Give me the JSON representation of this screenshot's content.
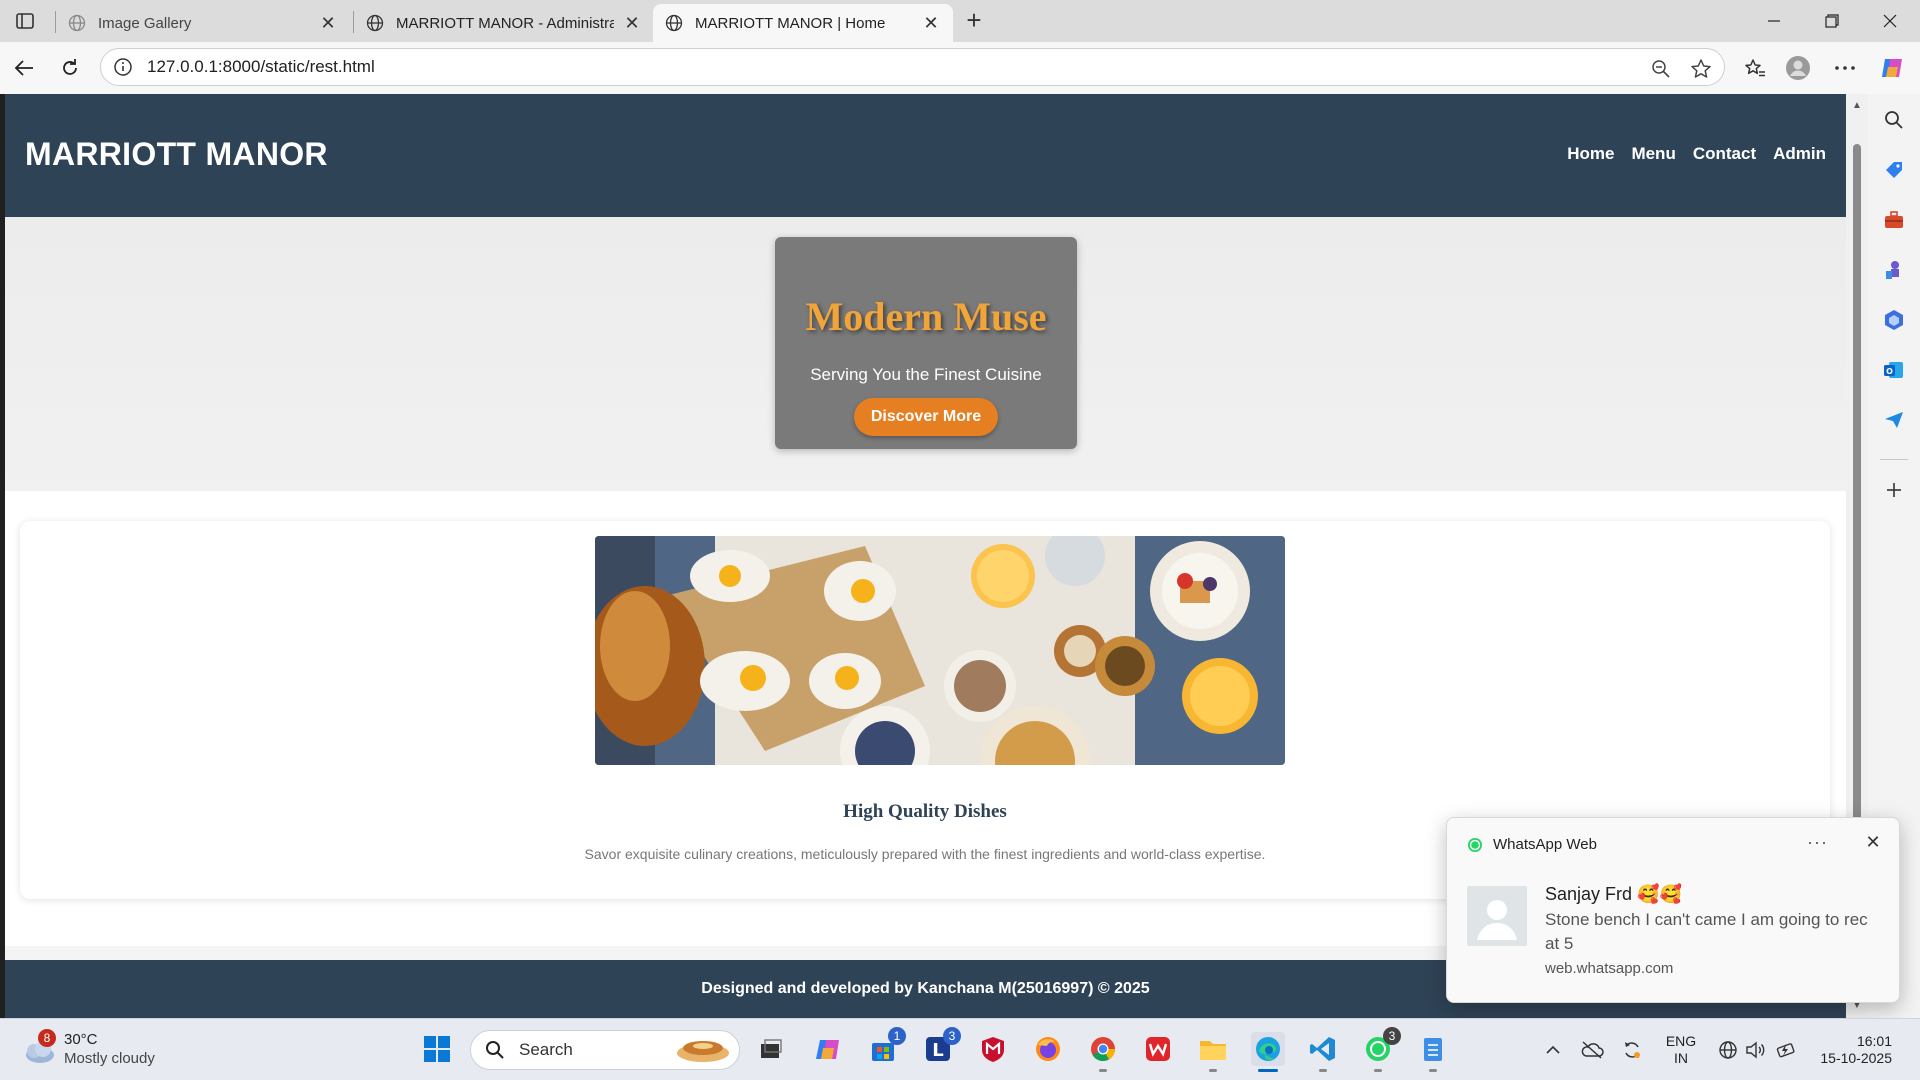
{
  "browser": {
    "tabs": [
      {
        "title": "Image Gallery",
        "active": false
      },
      {
        "title": "MARRIOTT MANOR - Administrat",
        "active": false
      },
      {
        "title": "MARRIOTT MANOR | Home",
        "active": true
      }
    ],
    "url": "127.0.0.1:8000/static/rest.html"
  },
  "site": {
    "logo": "MARRIOTT MANOR",
    "nav": [
      "Home",
      "Menu",
      "Contact",
      "Admin"
    ],
    "hero": {
      "title": "Modern Muse",
      "subtitle": "Serving You the Finest Cuisine",
      "button": "Discover More"
    },
    "feature": {
      "title": "High Quality Dishes",
      "description": "Savor exquisite culinary creations, meticulously prepared with the finest ingredients and world-class expertise."
    },
    "footer": "Designed and developed by Kanchana M(25016997) © 2025"
  },
  "notification": {
    "app": "WhatsApp Web",
    "sender": "Sanjay Frd 🥰🥰",
    "message": "Stone bench I can't came I am going to rec at 5",
    "source": "web.whatsapp.com"
  },
  "taskbar": {
    "weather": {
      "temp": "30°C",
      "desc": "Mostly cloudy",
      "badge": "8"
    },
    "search_placeholder": "Search",
    "badges": {
      "store": "1",
      "lens": "3",
      "whatsapp": "3"
    },
    "language": {
      "line1": "ENG",
      "line2": "IN"
    },
    "time": "16:01",
    "date": "15-10-2025"
  },
  "colors": {
    "header_bg": "#2f4356",
    "accent_orange": "#e67e22",
    "hero_title": "#f0a43a"
  }
}
